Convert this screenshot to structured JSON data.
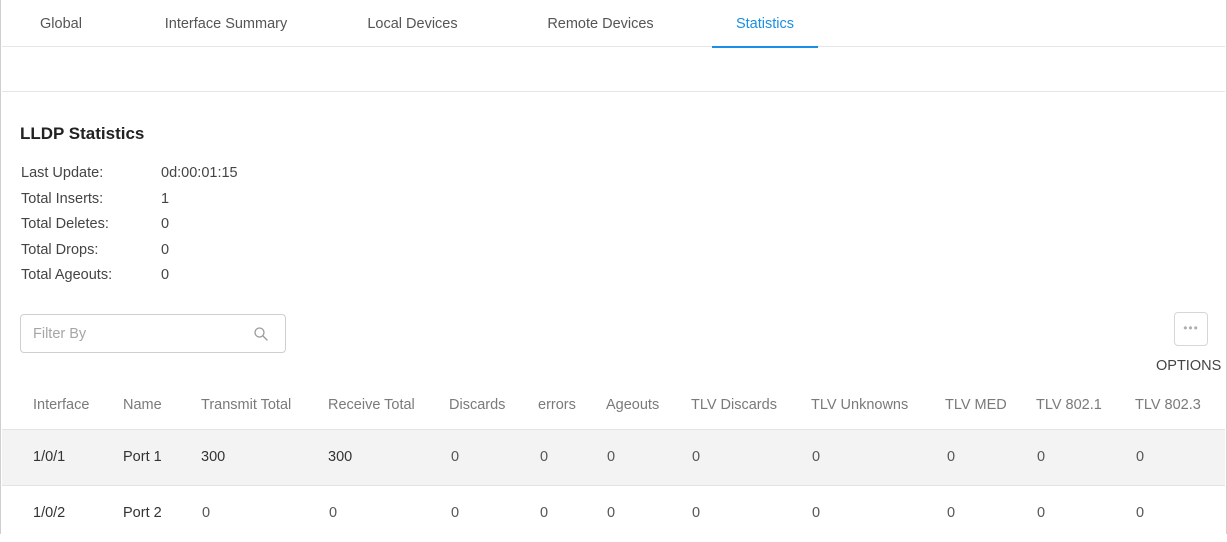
{
  "tabs": [
    {
      "label": "Global"
    },
    {
      "label": "Interface Summary"
    },
    {
      "label": "Local Devices"
    },
    {
      "label": "Remote Devices"
    },
    {
      "label": "Statistics",
      "active": true
    }
  ],
  "section_title": "LLDP Statistics",
  "stats": [
    {
      "label": "Last Update:",
      "value": "0d:00:01:15"
    },
    {
      "label": "Total Inserts:",
      "value": "1"
    },
    {
      "label": "Total Deletes:",
      "value": "0"
    },
    {
      "label": "Total Drops:",
      "value": "0"
    },
    {
      "label": "Total Ageouts:",
      "value": "0"
    }
  ],
  "filter": {
    "placeholder": "Filter By",
    "value": ""
  },
  "options": {
    "label": "OPTIONS"
  },
  "table": {
    "columns": [
      "Interface",
      "Name",
      "Transmit Total",
      "Receive Total",
      "Discards",
      "errors",
      "Ageouts",
      "TLV Discards",
      "TLV Unknowns",
      "TLV MED",
      "TLV 802.1",
      "TLV 802.3"
    ],
    "rows": [
      [
        "1/0/1",
        "Port 1",
        "300",
        "300",
        "0",
        "0",
        "0",
        "0",
        "0",
        "0",
        "0",
        "0"
      ],
      [
        "1/0/2",
        "Port 2",
        "0",
        "0",
        "0",
        "0",
        "0",
        "0",
        "0",
        "0",
        "0",
        "0"
      ]
    ]
  },
  "colors": {
    "accent": "#1a8fe3"
  },
  "icons": {
    "search": "search-icon",
    "options": "more-horizontal-icon"
  }
}
